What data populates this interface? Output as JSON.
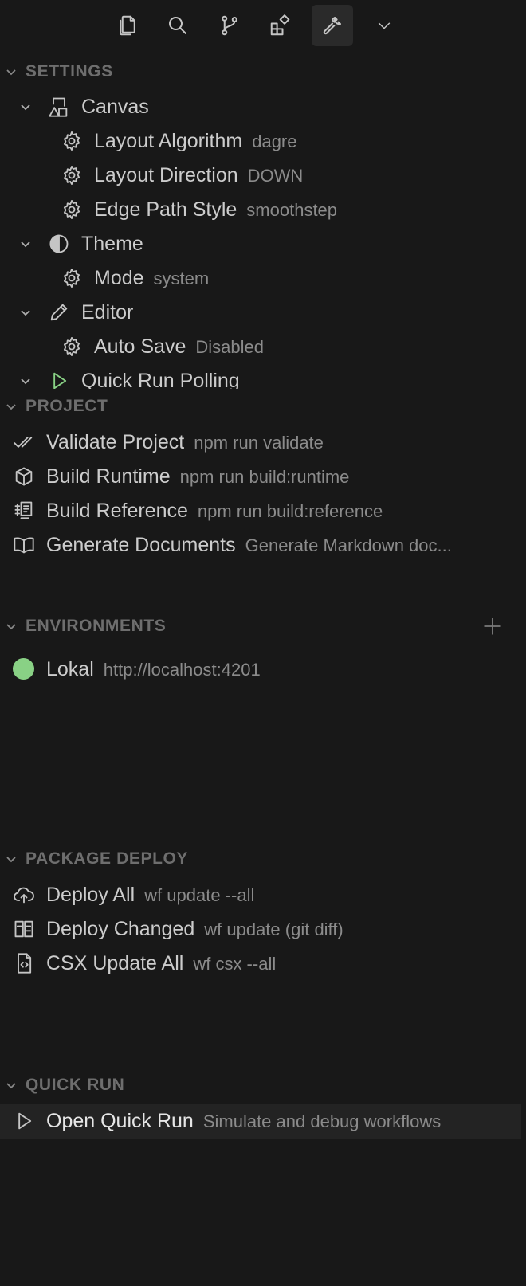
{
  "toolbar": {
    "buttons": [
      {
        "icon": "files-icon"
      },
      {
        "icon": "search-icon"
      },
      {
        "icon": "source-control-icon"
      },
      {
        "icon": "extensions-icon"
      },
      {
        "icon": "wrench-icon",
        "active": true
      },
      {
        "icon": "chevron-down-icon"
      }
    ]
  },
  "settings": {
    "title": "SETTINGS",
    "groups": [
      {
        "label": "Canvas",
        "icon": "shapes-icon",
        "items": [
          {
            "label": "Layout Algorithm",
            "value": "dagre"
          },
          {
            "label": "Layout Direction",
            "value": "DOWN"
          },
          {
            "label": "Edge Path Style",
            "value": "smoothstep"
          }
        ]
      },
      {
        "label": "Theme",
        "icon": "contrast-icon",
        "items": [
          {
            "label": "Mode",
            "value": "system"
          }
        ]
      },
      {
        "label": "Editor",
        "icon": "pencil-icon",
        "items": [
          {
            "label": "Auto Save",
            "value": "Disabled"
          }
        ]
      },
      {
        "label": "Quick Run Polling",
        "icon": "play-icon",
        "items": []
      }
    ]
  },
  "project": {
    "title": "PROJECT",
    "items": [
      {
        "label": "Validate Project",
        "desc": "npm run validate",
        "icon": "check-all-icon"
      },
      {
        "label": "Build Runtime",
        "desc": "npm run build:runtime",
        "icon": "package-icon"
      },
      {
        "label": "Build Reference",
        "desc": "npm run build:reference",
        "icon": "references-icon"
      },
      {
        "label": "Generate Documents",
        "desc": "Generate Markdown doc...",
        "icon": "book-icon"
      }
    ]
  },
  "environments": {
    "title": "ENVIRONMENTS",
    "items": [
      {
        "label": "Lokal",
        "desc": "http://localhost:4201",
        "status_color": "#89d185"
      }
    ]
  },
  "package_deploy": {
    "title": "PACKAGE DEPLOY",
    "items": [
      {
        "label": "Deploy All",
        "desc": "wf update --all",
        "icon": "cloud-upload-icon"
      },
      {
        "label": "Deploy Changed",
        "desc": "wf update (git diff)",
        "icon": "diff-icon"
      },
      {
        "label": "CSX Update All",
        "desc": "wf csx --all",
        "icon": "file-code-icon"
      }
    ]
  },
  "quick_run": {
    "title": "QUICK RUN",
    "items": [
      {
        "label": "Open Quick Run",
        "desc": "Simulate and debug workflows",
        "icon": "play-icon"
      }
    ]
  },
  "colors": {
    "background": "#181818",
    "accent_play": "#89d185",
    "status_ok": "#89d185"
  }
}
